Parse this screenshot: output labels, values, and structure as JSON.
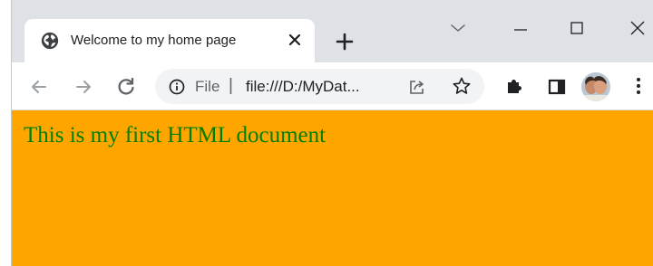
{
  "colors": {
    "tabstrip_bg": "#dee1e6",
    "omnibox_bg": "#f1f3f4",
    "page_background": "#ffa500",
    "page_text": "#008000",
    "icon_gray": "#5f6368",
    "icon_dark": "#202124"
  },
  "tab": {
    "title": "Welcome to my home page",
    "favicon": "globe-icon",
    "close_icon": "close-icon"
  },
  "tabstrip": {
    "new_tab_icon": "plus-icon",
    "tab_search_icon": "chevron-down-icon"
  },
  "window_controls": [
    "minimize-icon",
    "maximize-icon",
    "close-icon"
  ],
  "toolbar": {
    "back_icon": "back-arrow-icon",
    "forward_icon": "forward-arrow-icon",
    "reload_icon": "reload-icon",
    "extensions_icon": "puzzle-icon",
    "side_panel_icon": "side-panel-icon",
    "menu_icon": "kebab-menu-icon"
  },
  "omnibox": {
    "scheme_label": "File",
    "separator": "|",
    "url": "file:///D:/MyDat...",
    "share_icon": "share-icon",
    "bookmark_icon": "star-icon"
  },
  "page": {
    "text": "This is my first HTML document"
  }
}
